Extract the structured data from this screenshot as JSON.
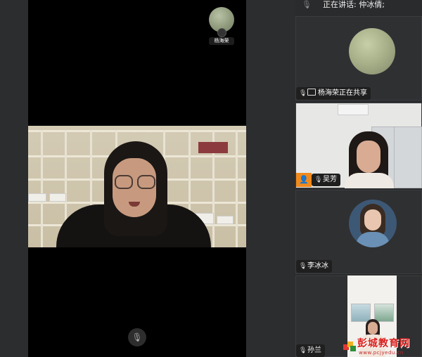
{
  "speaker_bar": {
    "label": "正在讲话:  仲冰倩;"
  },
  "presenter": {
    "name": "杨海荣"
  },
  "participants": [
    {
      "name": "杨海荣正在共享",
      "status": "sharing"
    },
    {
      "name": "吴芳",
      "status": "video"
    },
    {
      "name": "李冰冰",
      "status": "muted"
    },
    {
      "name": "孙兰",
      "status": "video"
    }
  ],
  "icons": {
    "mic": "🎙",
    "muted_mic": "🎙",
    "person": "👤"
  },
  "watermark": {
    "title": "彭城教育网",
    "url": "www.pcjyedu.cn"
  },
  "colors": {
    "stage": "#000000",
    "sidebar": "#2a2b2d",
    "watermark_red": "#d8201d",
    "person_badge": "#f08a1c"
  }
}
